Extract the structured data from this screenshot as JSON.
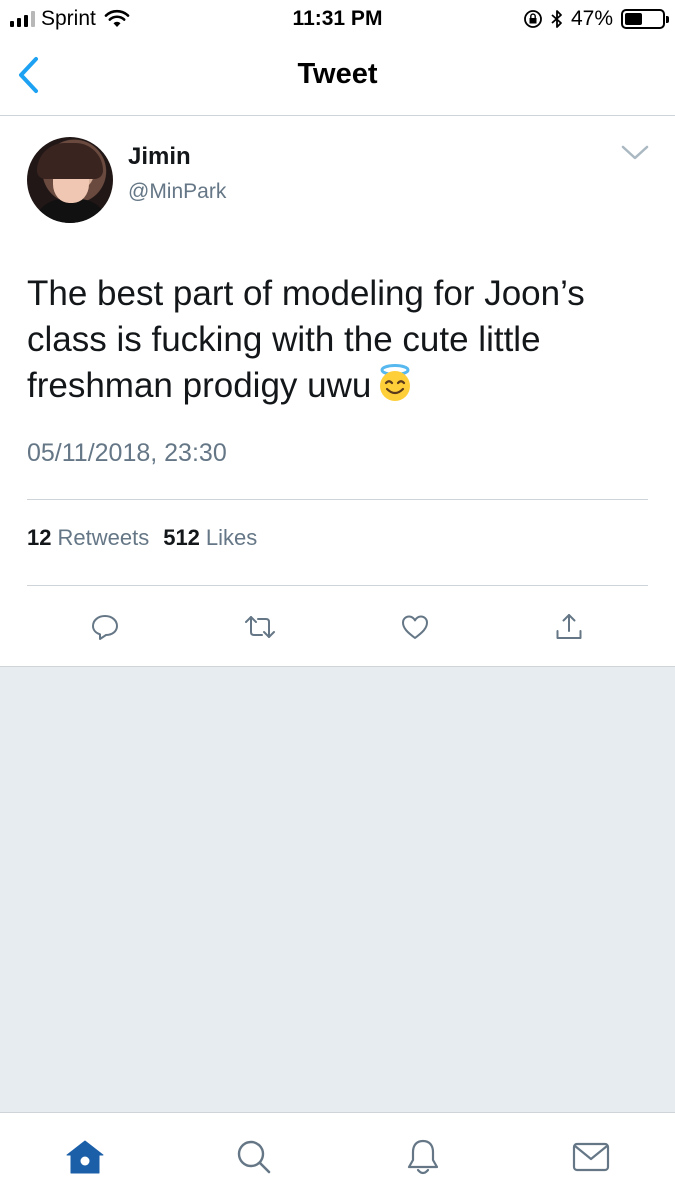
{
  "status_bar": {
    "carrier": "Sprint",
    "time": "11:31 PM",
    "battery_percent": "47%",
    "battery_level": 0.47
  },
  "nav": {
    "title": "Tweet",
    "back_icon": "chevron-left-icon"
  },
  "tweet": {
    "author_name": "Jimin",
    "author_handle": "@MinPark",
    "text": "The best part of modeling for Joon’s class is fucking with the cute little freshman prodigy uwu",
    "emoji": "smiling-face-with-halo",
    "timestamp": "05/11/2018, 23:30",
    "retweet_count": "12",
    "retweet_label": "Retweets",
    "like_count": "512",
    "like_label": "Likes"
  },
  "actions": [
    "reply-icon",
    "retweet-icon",
    "like-icon",
    "share-icon"
  ],
  "tab_bar": [
    "home-icon",
    "search-icon",
    "notifications-icon",
    "messages-icon"
  ],
  "colors": {
    "accent": "#1da1f2",
    "tab_active": "#1b5fa8",
    "secondary_text": "#657786",
    "icon_gray": "#657786",
    "divider": "#cfd4d9",
    "background_empty": "#e6ecf0"
  }
}
